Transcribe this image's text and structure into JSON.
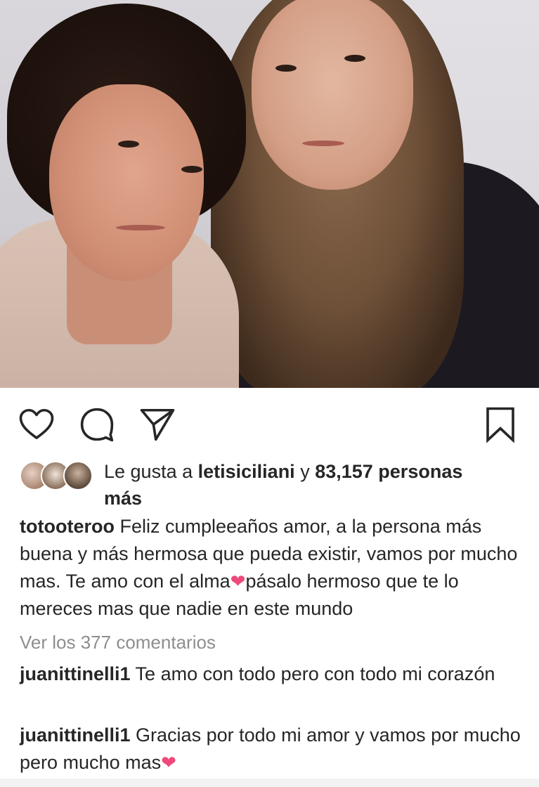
{
  "post": {
    "likes": {
      "prefix": "Le gusta a",
      "user": "letisiciliani",
      "joiner": "y",
      "count_text": "83,157 personas",
      "suffix": "más"
    },
    "caption": {
      "username": "totooteroo",
      "text_before_heart": "Feliz cumpleeaños amor, a la persona más buena y más hermosa que pueda existir, vamos por mucho mas. Te amo con el alma",
      "text_after_heart": "pásalo hermoso que te lo mereces mas que nadie en este mundo"
    },
    "view_comments": "Ver los 377 comentarios",
    "comments": [
      {
        "username": "juanittinelli1",
        "text": "Te amo con todo pero con todo mi corazón"
      },
      {
        "username": "juanittinelli1",
        "text": "Gracias por todo mi amor y vamos por mucho pero mucho mas"
      }
    ]
  },
  "icons": {
    "like": "heart-outline-icon",
    "comment": "speech-bubble-icon",
    "share": "paper-plane-icon",
    "save": "bookmark-icon",
    "emoji_heart": "pink-heart-emoji"
  },
  "colors": {
    "text": "#262626",
    "muted": "#8e8e8e",
    "heart": "#ed4a7b"
  }
}
